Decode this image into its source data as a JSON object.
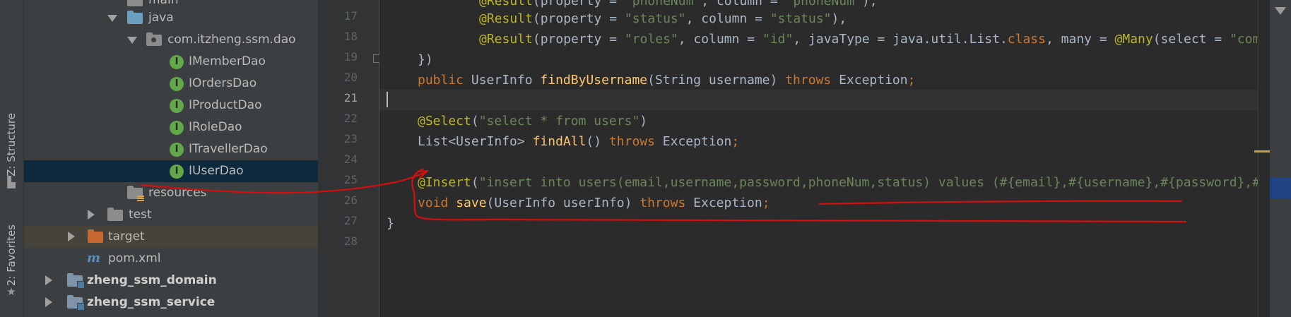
{
  "left_strip": {
    "structure_tab": "Z: Structure",
    "favorites_tab": "2: Favorites",
    "structure_icon": "structure-icon",
    "favorites_icon": "star-icon"
  },
  "project_tree": {
    "items": [
      {
        "label": "main",
        "icon": "folder"
      },
      {
        "label": "java",
        "icon": "source-folder"
      },
      {
        "label": "com.itzheng.ssm.dao",
        "icon": "package"
      },
      {
        "label": "IMemberDao",
        "icon": "interface"
      },
      {
        "label": "IOrdersDao",
        "icon": "interface"
      },
      {
        "label": "IProductDao",
        "icon": "interface"
      },
      {
        "label": "IRoleDao",
        "icon": "interface"
      },
      {
        "label": "ITravellerDao",
        "icon": "interface"
      },
      {
        "label": "IUserDao",
        "icon": "interface",
        "selected": true
      },
      {
        "label": "resources",
        "icon": "resources-folder"
      },
      {
        "label": "test",
        "icon": "folder"
      },
      {
        "label": "target",
        "icon": "excluded-folder"
      },
      {
        "label": "pom.xml",
        "icon": "maven"
      },
      {
        "label": "zheng_ssm_domain",
        "icon": "module"
      },
      {
        "label": "zheng_ssm_service",
        "icon": "module"
      }
    ]
  },
  "editor": {
    "line_numbers": [
      "17",
      "18",
      "19",
      "20",
      "21",
      "22",
      "23",
      "24",
      "25",
      "26",
      "27",
      "28"
    ],
    "current_line": "21",
    "lines": {
      "l16": [
        [
          "a",
          "@Result"
        ],
        [
          "p",
          "(property = "
        ],
        [
          "s",
          "\"phoneNum\""
        ],
        [
          "p",
          ", column = "
        ],
        [
          "s",
          "\"phoneNum\""
        ],
        [
          "p",
          "),"
        ]
      ],
      "l17": [
        [
          "a",
          "@Result"
        ],
        [
          "p",
          "(property = "
        ],
        [
          "s",
          "\"status\""
        ],
        [
          "p",
          ", column = "
        ],
        [
          "s",
          "\"status\""
        ],
        [
          "p",
          "),"
        ]
      ],
      "l18": [
        [
          "a",
          "@Result"
        ],
        [
          "p",
          "(property = "
        ],
        [
          "s",
          "\"roles\""
        ],
        [
          "p",
          ", column = "
        ],
        [
          "s",
          "\"id\""
        ],
        [
          "p",
          ", javaType = java.util.List."
        ],
        [
          "k",
          "class"
        ],
        [
          "p",
          ", many = "
        ],
        [
          "a",
          "@Many"
        ],
        [
          "p",
          "(select = "
        ],
        [
          "s",
          "\"com"
        ]
      ],
      "l19": [
        [
          "p",
          "})"
        ]
      ],
      "l20": [
        [
          "k",
          "public "
        ],
        [
          "p",
          "UserInfo "
        ],
        [
          "f",
          "findByUsername"
        ],
        [
          "p",
          "(String username) "
        ],
        [
          "k",
          "throws "
        ],
        [
          "p",
          "Exception"
        ],
        [
          "k",
          ";"
        ]
      ],
      "l22": [
        [
          "a",
          "@Select"
        ],
        [
          "p",
          "("
        ],
        [
          "s",
          "\"select * from users\""
        ],
        [
          "p",
          ")"
        ]
      ],
      "l23": [
        [
          "p",
          "List<UserInfo> "
        ],
        [
          "f",
          "findAll"
        ],
        [
          "p",
          "() "
        ],
        [
          "k",
          "throws "
        ],
        [
          "p",
          "Exception"
        ],
        [
          "k",
          ";"
        ]
      ],
      "l25": [
        [
          "a",
          "@Insert"
        ],
        [
          "p",
          "("
        ],
        [
          "s",
          "\"insert into users(email,username,password,phoneNum,status) values (#{email},#{username},#{password},#"
        ]
      ],
      "l26": [
        [
          "k",
          "void "
        ],
        [
          "f",
          "save"
        ],
        [
          "p",
          "(UserInfo userInfo) "
        ],
        [
          "k",
          "throws "
        ],
        [
          "p",
          "Exception"
        ],
        [
          "k",
          ";"
        ]
      ],
      "l27": [
        [
          "p",
          "}"
        ]
      ]
    }
  },
  "colors": {
    "keyword": "#cc7832",
    "string": "#6a8759",
    "annotation": "#bbb529",
    "method": "#ffc66d",
    "plain": "#a9b7c6",
    "selection": "#0d293e",
    "annotation_ink": "#d40f0f"
  }
}
